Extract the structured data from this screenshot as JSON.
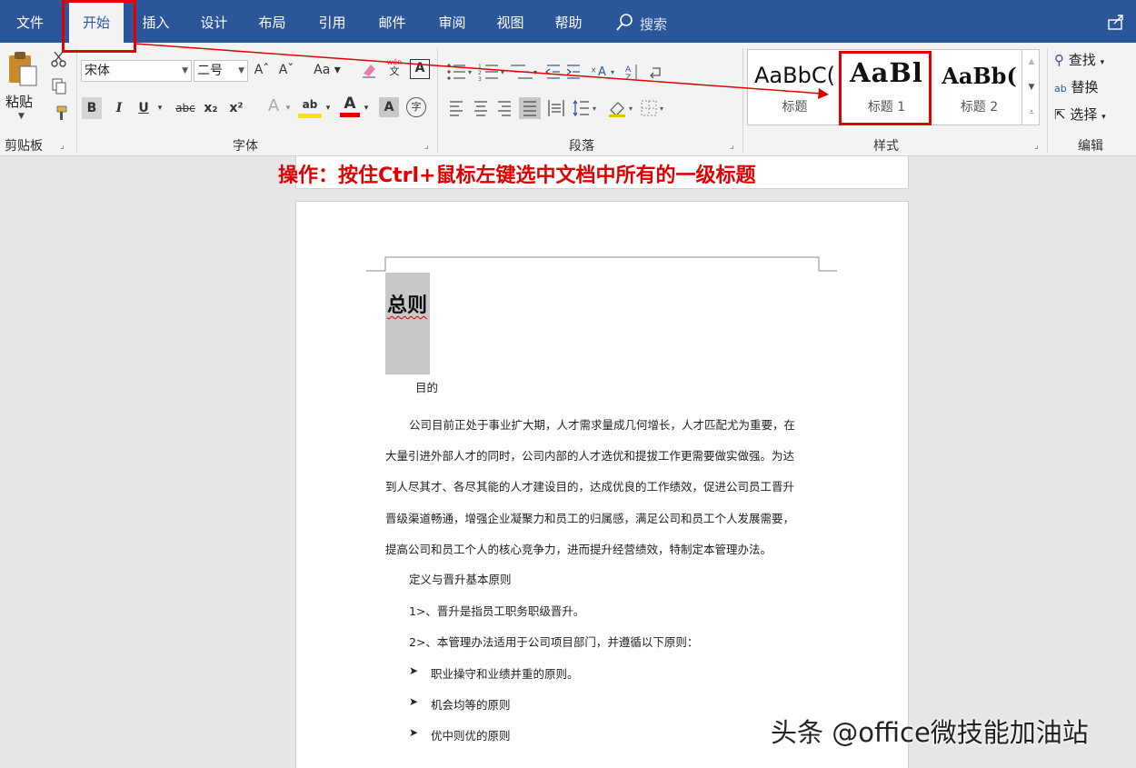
{
  "tabs": [
    "文件",
    "开始",
    "插入",
    "设计",
    "布局",
    "引用",
    "邮件",
    "审阅",
    "视图",
    "帮助"
  ],
  "search": {
    "label": "搜索"
  },
  "clipboard": {
    "paste": "粘贴",
    "group": "剪贴板"
  },
  "font": {
    "name": "宋体",
    "size": "二号",
    "group": "字体",
    "case_label": "Aa",
    "phonetic_char": "文",
    "bold": "B",
    "italic": "I",
    "underline": "U",
    "strike": "abc",
    "subscript": "x₂",
    "superscript": "x²",
    "aa_label": "A",
    "highlight_label": "ab",
    "font_color_label": "A",
    "shading_label": "A",
    "enclose_char": "字"
  },
  "paragraph": {
    "group": "段落"
  },
  "styles": {
    "group": "样式",
    "items": [
      {
        "sample": "AaBbC(",
        "name": "标题"
      },
      {
        "sample": "AaBl",
        "name": "标题 1"
      },
      {
        "sample": "AaBb(",
        "name": "标题 2"
      }
    ]
  },
  "editing": {
    "find": "查找",
    "replace": "替换",
    "select": "选择",
    "group": "编辑"
  },
  "annotation": "操作：按住Ctrl+鼠标左键选中文档中所有的一级标题",
  "document": {
    "heading": "总则",
    "subheading": "目的",
    "paragraph_lines": [
      "公司目前正处于事业扩大期，人才需求量成几何增长，人才匹配尤为重要，在",
      "大量引进外部人才的同时，公司内部的人才选优和提拔工作更需要做实做强。为达",
      "到人尽其才、各尽其能的人才建设目的，达成优良的工作绩效，促进公司员工晋升",
      "晋级渠道畅通，增强企业凝聚力和员工的归属感，满足公司和员工个人发展需要，",
      "提高公司和员工个人的核心竞争力，进而提升经营绩效，特制定本管理办法。"
    ],
    "section2": "定义与晋升基本原则",
    "items": [
      "1>、晋升是指员工职务职级晋升。",
      "2>、本管理办法适用于公司项目部门，并遵循以下原则："
    ],
    "bullets": [
      "职业操守和业绩并重的原则。",
      "机会均等的原则",
      "优中则优的原则"
    ]
  },
  "watermark": "头条 @office微技能加油站",
  "colors": {
    "ribbon_blue": "#2b579a",
    "annotation_red": "#e00000",
    "selection_gray": "#c8c8c8"
  }
}
